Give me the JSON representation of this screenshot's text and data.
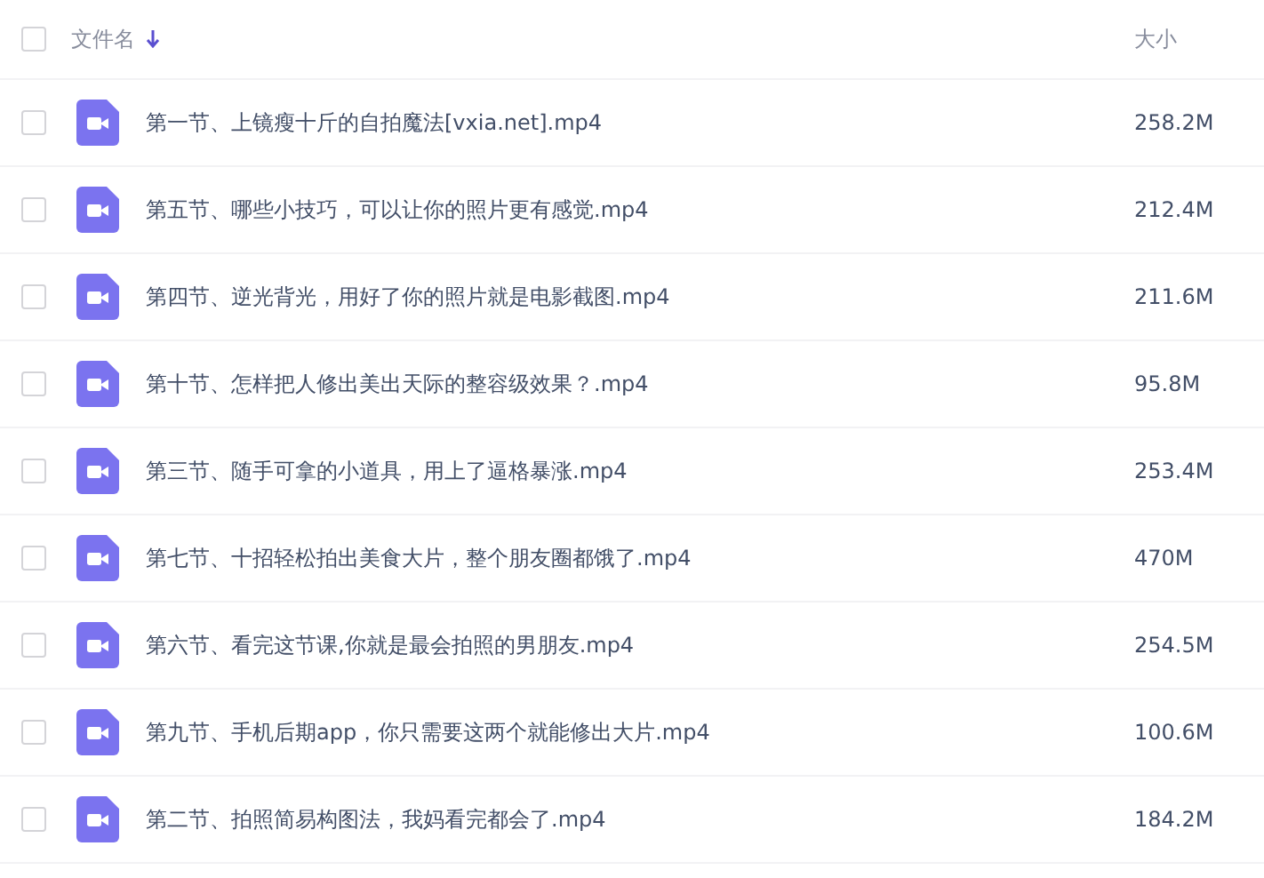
{
  "table": {
    "select_all": {
      "checked": false
    },
    "columns": [
      {
        "label": "文件名",
        "sorted": true
      },
      {
        "label": "大小"
      }
    ],
    "rows": [
      {
        "name": "第一节、上镜瘦十斤的自拍魔法[vxia.net].mp4",
        "size": "258.2M",
        "checked": false
      },
      {
        "name": "第五节、哪些小技巧，可以让你的照片更有感觉.mp4",
        "size": "212.4M",
        "checked": false
      },
      {
        "name": "第四节、逆光背光，用好了你的照片就是电影截图.mp4",
        "size": "211.6M",
        "checked": false
      },
      {
        "name": "第十节、怎样把人修出美出天际的整容级效果？.mp4",
        "size": "95.8M",
        "checked": false
      },
      {
        "name": "第三节、随手可拿的小道具，用上了逼格暴涨.mp4",
        "size": "253.4M",
        "checked": false
      },
      {
        "name": "第七节、十招轻松拍出美食大片，整个朋友圈都饿了.mp4",
        "size": "470M",
        "checked": false
      },
      {
        "name": "第六节、看完这节课,你就是最会拍照的男朋友.mp4",
        "size": "254.5M",
        "checked": false
      },
      {
        "name": "第九节、手机后期app，你只需要这两个就能修出大片.mp4",
        "size": "100.6M",
        "checked": false
      },
      {
        "name": "第二节、拍照简易构图法，我妈看完都会了.mp4",
        "size": "184.2M",
        "checked": false
      }
    ]
  }
}
